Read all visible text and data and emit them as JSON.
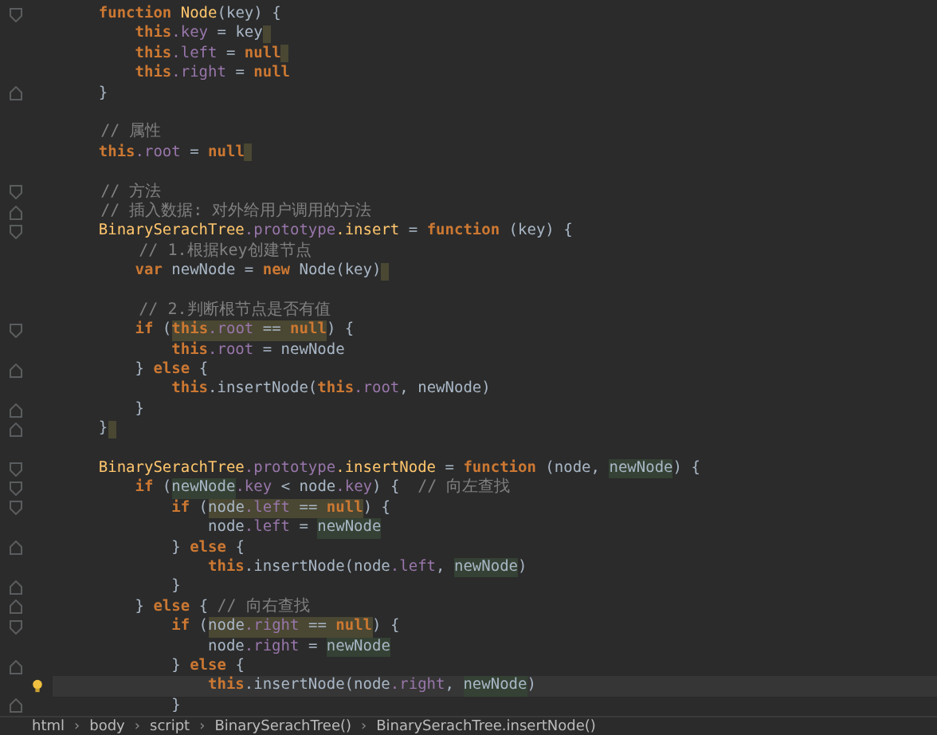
{
  "lines": [
    {
      "kind": "code",
      "end_mark": false,
      "gutter": {
        "kind": "fold_start"
      },
      "tokens": [
        {
          "text": "    function",
          "kind": "keyword"
        },
        {
          "text": " Node",
          "kind": "function"
        },
        {
          "text": "(key) {"
        }
      ]
    },
    {
      "kind": "code",
      "end_mark": true,
      "tokens": [
        {
          "text": "        this",
          "kind": "keyword"
        },
        {
          "text": ".key",
          "kind": "member"
        },
        {
          "text": " = key"
        }
      ]
    },
    {
      "kind": "code",
      "end_mark": true,
      "tokens": [
        {
          "text": "        this",
          "kind": "keyword"
        },
        {
          "text": ".left",
          "kind": "member"
        },
        {
          "text": " = "
        },
        {
          "text": "null",
          "kind": "keyword"
        }
      ]
    },
    {
      "kind": "code",
      "end_mark": false,
      "tokens": [
        {
          "text": "        this",
          "kind": "keyword"
        },
        {
          "text": ".right",
          "kind": "member"
        },
        {
          "text": " = "
        },
        {
          "text": "null",
          "kind": "keyword"
        }
      ]
    },
    {
      "kind": "code",
      "end_mark": false,
      "gutter": {
        "kind": "fold_end"
      },
      "tokens": [
        {
          "text": "    }"
        }
      ]
    },
    {
      "kind": "blank"
    },
    {
      "kind": "code",
      "end_mark": false,
      "tokens": [
        {
          "text": "    // 属性",
          "kind": "comment"
        }
      ]
    },
    {
      "kind": "code",
      "end_mark": true,
      "tokens": [
        {
          "text": "    this",
          "kind": "keyword"
        },
        {
          "text": ".root",
          "kind": "member"
        },
        {
          "text": " = "
        },
        {
          "text": "null",
          "kind": "keyword"
        }
      ]
    },
    {
      "kind": "blank"
    },
    {
      "kind": "code",
      "end_mark": false,
      "gutter": {
        "kind": "fold_start"
      },
      "tokens": [
        {
          "text": "    // 方法",
          "kind": "comment"
        }
      ]
    },
    {
      "kind": "code",
      "end_mark": false,
      "gutter": {
        "kind": "fold_end"
      },
      "tokens": [
        {
          "text": "    // 插入数据: 对外给用户调用的方法",
          "kind": "comment"
        }
      ]
    },
    {
      "kind": "code",
      "end_mark": false,
      "gutter": {
        "kind": "fold_start"
      },
      "tokens": [
        {
          "text": "    BinarySerachTree",
          "kind": "function"
        },
        {
          "text": ".prototype",
          "kind": "member"
        },
        {
          "text": ".insert",
          "kind": "function"
        },
        {
          "text": " = "
        },
        {
          "text": "function",
          "kind": "keyword"
        },
        {
          "text": " (key) {"
        }
      ]
    },
    {
      "kind": "code",
      "end_mark": false,
      "tokens": [
        {
          "text": "        // 1.根据key创建节点",
          "kind": "comment"
        }
      ]
    },
    {
      "kind": "code",
      "end_mark": true,
      "tokens": [
        {
          "text": "        var",
          "kind": "keyword"
        },
        {
          "text": " newNode = "
        },
        {
          "text": "new",
          "kind": "keyword"
        },
        {
          "text": " Node(key)"
        }
      ]
    },
    {
      "kind": "blank"
    },
    {
      "kind": "code",
      "end_mark": false,
      "tokens": [
        {
          "text": "        // 2.判断根节点是否有值",
          "kind": "comment"
        }
      ]
    },
    {
      "kind": "code",
      "end_mark": false,
      "gutter": {
        "kind": "fold_start"
      },
      "tokens": [
        {
          "text": "        if",
          "kind": "keyword"
        },
        {
          "text": " ("
        },
        {
          "text": "this",
          "kind": "keyword",
          "highlight": {
            "kind": "warning"
          }
        },
        {
          "text": ".root",
          "kind": "member",
          "highlight": {
            "kind": "warning"
          }
        },
        {
          "text": " == ",
          "highlight": {
            "kind": "warning"
          }
        },
        {
          "text": "null",
          "kind": "keyword",
          "highlight": {
            "kind": "warning"
          }
        },
        {
          "text": ") {"
        }
      ]
    },
    {
      "kind": "code",
      "end_mark": false,
      "tokens": [
        {
          "text": "            this",
          "kind": "keyword"
        },
        {
          "text": ".root",
          "kind": "member"
        },
        {
          "text": " = newNode"
        }
      ]
    },
    {
      "kind": "code",
      "end_mark": false,
      "gutter": {
        "kind": "fold_end"
      },
      "tokens": [
        {
          "text": "        } "
        },
        {
          "text": "else",
          "kind": "keyword"
        },
        {
          "text": " {"
        }
      ]
    },
    {
      "kind": "code",
      "end_mark": false,
      "tokens": [
        {
          "text": "            this",
          "kind": "keyword"
        },
        {
          "text": ".insertNode("
        },
        {
          "text": "this",
          "kind": "keyword"
        },
        {
          "text": ".root",
          "kind": "member"
        },
        {
          "text": ", newNode)"
        }
      ]
    },
    {
      "kind": "code",
      "end_mark": false,
      "gutter": {
        "kind": "fold_end"
      },
      "tokens": [
        {
          "text": "        }"
        }
      ]
    },
    {
      "kind": "code",
      "end_mark": true,
      "gutter": {
        "kind": "fold_end"
      },
      "tokens": [
        {
          "text": "    }"
        }
      ]
    },
    {
      "kind": "blank"
    },
    {
      "kind": "code",
      "end_mark": false,
      "gutter": {
        "kind": "fold_start"
      },
      "tokens": [
        {
          "text": "    BinarySerachTree",
          "kind": "function"
        },
        {
          "text": ".prototype",
          "kind": "member"
        },
        {
          "text": ".insertNode",
          "kind": "function"
        },
        {
          "text": " = "
        },
        {
          "text": "function",
          "kind": "keyword"
        },
        {
          "text": " (node, "
        },
        {
          "text": "newNode",
          "highlight": {
            "kind": "usage"
          }
        },
        {
          "text": ") {"
        }
      ]
    },
    {
      "kind": "code",
      "end_mark": false,
      "gutter": {
        "kind": "fold_start"
      },
      "tokens": [
        {
          "text": "        if",
          "kind": "keyword"
        },
        {
          "text": " ("
        },
        {
          "text": "newNode",
          "highlight": {
            "kind": "usage"
          }
        },
        {
          "text": ".key",
          "kind": "member"
        },
        {
          "text": " < node"
        },
        {
          "text": ".key",
          "kind": "member"
        },
        {
          "text": ") {  "
        },
        {
          "text": "// 向左查找",
          "kind": "comment"
        }
      ]
    },
    {
      "kind": "code",
      "end_mark": false,
      "gutter": {
        "kind": "fold_start"
      },
      "tokens": [
        {
          "text": "            if",
          "kind": "keyword"
        },
        {
          "text": " ("
        },
        {
          "text": "node",
          "highlight": {
            "kind": "warning"
          }
        },
        {
          "text": ".left",
          "kind": "member",
          "highlight": {
            "kind": "warning"
          }
        },
        {
          "text": " == ",
          "highlight": {
            "kind": "warning"
          }
        },
        {
          "text": "null",
          "kind": "keyword",
          "highlight": {
            "kind": "warning"
          }
        },
        {
          "text": ") {"
        }
      ]
    },
    {
      "kind": "code",
      "end_mark": false,
      "tokens": [
        {
          "text": "                node"
        },
        {
          "text": ".left",
          "kind": "member"
        },
        {
          "text": " = "
        },
        {
          "text": "newNode",
          "highlight": {
            "kind": "usage"
          }
        }
      ]
    },
    {
      "kind": "code",
      "end_mark": false,
      "gutter": {
        "kind": "fold_end"
      },
      "tokens": [
        {
          "text": "            } "
        },
        {
          "text": "else",
          "kind": "keyword"
        },
        {
          "text": " {"
        }
      ]
    },
    {
      "kind": "code",
      "end_mark": false,
      "tokens": [
        {
          "text": "                this",
          "kind": "keyword"
        },
        {
          "text": ".insertNode(node"
        },
        {
          "text": ".left",
          "kind": "member"
        },
        {
          "text": ", "
        },
        {
          "text": "newNode",
          "highlight": {
            "kind": "usage"
          }
        },
        {
          "text": ")"
        }
      ]
    },
    {
      "kind": "code",
      "end_mark": false,
      "gutter": {
        "kind": "fold_end"
      },
      "tokens": [
        {
          "text": "            }"
        }
      ]
    },
    {
      "kind": "code",
      "end_mark": false,
      "gutter": {
        "kind": "fold_end"
      },
      "tokens": [
        {
          "text": "        } "
        },
        {
          "text": "else",
          "kind": "keyword"
        },
        {
          "text": " { "
        },
        {
          "text": "// 向右查找",
          "kind": "comment"
        }
      ]
    },
    {
      "kind": "code",
      "end_mark": false,
      "gutter": {
        "kind": "fold_start"
      },
      "tokens": [
        {
          "text": "            if",
          "kind": "keyword"
        },
        {
          "text": " ("
        },
        {
          "text": "node",
          "highlight": {
            "kind": "warning"
          }
        },
        {
          "text": ".right",
          "kind": "member",
          "highlight": {
            "kind": "warning"
          }
        },
        {
          "text": " == ",
          "highlight": {
            "kind": "warning"
          }
        },
        {
          "text": "null",
          "kind": "keyword",
          "highlight": {
            "kind": "warning"
          }
        },
        {
          "text": ") {"
        }
      ]
    },
    {
      "kind": "code",
      "end_mark": false,
      "tokens": [
        {
          "text": "                node"
        },
        {
          "text": ".right",
          "kind": "member"
        },
        {
          "text": " = "
        },
        {
          "text": "newNode",
          "highlight": {
            "kind": "usage"
          }
        }
      ]
    },
    {
      "kind": "code",
      "end_mark": false,
      "gutter": {
        "kind": "fold_end"
      },
      "tokens": [
        {
          "text": "            } "
        },
        {
          "text": "else",
          "kind": "keyword"
        },
        {
          "text": " {"
        }
      ]
    },
    {
      "kind": "current_code",
      "end_mark": false,
      "tokens": [
        {
          "text": "                this",
          "kind": "keyword"
        },
        {
          "text": ".insertNode(node"
        },
        {
          "text": ".right",
          "kind": "member"
        },
        {
          "text": ", "
        },
        {
          "text": "newNode",
          "highlight": {
            "kind": "usage"
          }
        },
        {
          "text": ")"
        }
      ]
    },
    {
      "kind": "code",
      "end_mark": false,
      "gutter": {
        "kind": "fold_end"
      },
      "tokens": [
        {
          "text": "            }"
        }
      ]
    }
  ],
  "breadcrumbs": [
    {
      "label": "html"
    },
    {
      "label": "body"
    },
    {
      "label": "script"
    },
    {
      "label": "BinarySerachTree()"
    },
    {
      "label": "BinarySerachTree.insertNode()"
    }
  ],
  "breadcrumb_separator": "›"
}
